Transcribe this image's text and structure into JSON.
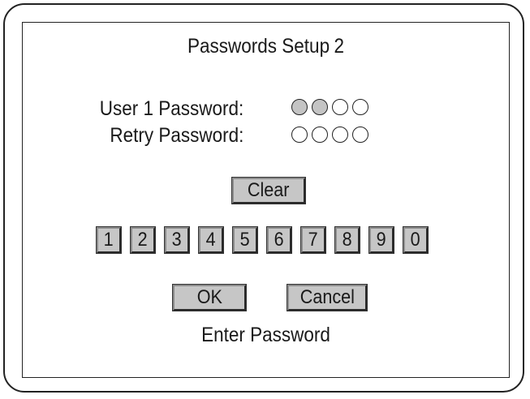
{
  "screen": {
    "title": "Passwords Setup",
    "title_number": "2",
    "status_text": "Enter Password"
  },
  "password": {
    "user_label": "User 1 Password:",
    "retry_label": "Retry Password:",
    "length": 4,
    "user_entered_count": 2,
    "retry_entered_count": 0
  },
  "buttons": {
    "clear_label": "Clear",
    "ok_label": "OK",
    "cancel_label": "Cancel"
  },
  "keypad": {
    "digits": [
      "1",
      "2",
      "3",
      "4",
      "5",
      "6",
      "7",
      "8",
      "9",
      "0"
    ]
  },
  "colors": {
    "filled_dot": "#c4c4c4",
    "empty_dot": "#ffffff",
    "key_face": "#c6c6c6"
  }
}
